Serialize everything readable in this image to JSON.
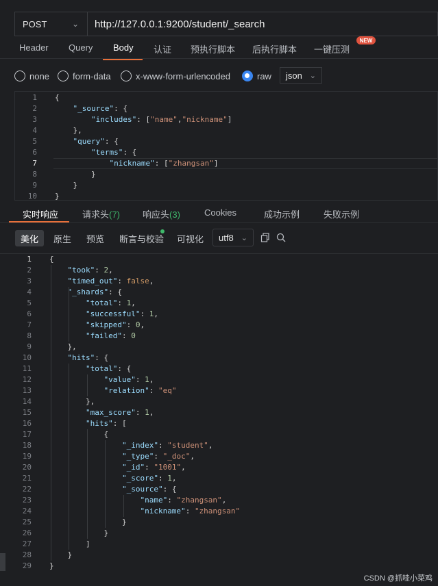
{
  "request": {
    "method": "POST",
    "url": "http://127.0.0.1:9200/student/_search"
  },
  "request_tabs": [
    {
      "label": "Header",
      "active": false
    },
    {
      "label": "Query",
      "active": false
    },
    {
      "label": "Body",
      "active": true
    },
    {
      "label": "认证",
      "active": false
    },
    {
      "label": "预执行脚本",
      "active": false
    },
    {
      "label": "后执行脚本",
      "active": false
    },
    {
      "label": "一键压测",
      "active": false,
      "badge": "NEW"
    }
  ],
  "body_types": [
    {
      "label": "none",
      "selected": false
    },
    {
      "label": "form-data",
      "selected": false
    },
    {
      "label": "x-www-form-urlencoded",
      "selected": false
    },
    {
      "label": "raw",
      "selected": true
    }
  ],
  "raw_format": "json",
  "request_body_lines": [
    "{",
    "    \"_source\": {",
    "        \"includes\": [\"name\",\"nickname\"]",
    "    },",
    "    \"query\": {",
    "        \"terms\": {",
    "            \"nickname\": [\"zhangsan\"]",
    "        }",
    "    }",
    "}"
  ],
  "request_current_line": 7,
  "response_tabs": [
    {
      "label": "实时响应",
      "active": true
    },
    {
      "label": "请求头",
      "count": "(7)"
    },
    {
      "label": "响应头",
      "count": "(3)"
    },
    {
      "label": "Cookies"
    },
    {
      "label": "成功示例"
    },
    {
      "label": "失败示例"
    }
  ],
  "response_views": [
    {
      "label": "美化",
      "active": true
    },
    {
      "label": "原生",
      "active": false
    },
    {
      "label": "预览",
      "active": false
    },
    {
      "label": "断言与校验",
      "active": false
    },
    {
      "label": "可视化",
      "active": false
    }
  ],
  "encoding": "utf8",
  "response_body_lines": [
    "{",
    "    \"took\": 2,",
    "    \"timed_out\": false,",
    "    \"_shards\": {",
    "        \"total\": 1,",
    "        \"successful\": 1,",
    "        \"skipped\": 0,",
    "        \"failed\": 0",
    "    },",
    "    \"hits\": {",
    "        \"total\": {",
    "            \"value\": 1,",
    "            \"relation\": \"eq\"",
    "        },",
    "        \"max_score\": 1,",
    "        \"hits\": [",
    "            {",
    "                \"_index\": \"student\",",
    "                \"_type\": \"_doc\",",
    "                \"_id\": \"1001\",",
    "                \"_score\": 1,",
    "                \"_source\": {",
    "                    \"name\": \"zhangsan\",",
    "                    \"nickname\": \"zhangsan\"",
    "                }",
    "            }",
    "        ]",
    "    }",
    "}"
  ],
  "response_current_line": 1,
  "watermark": "CSDN @抓哇小菜鸡",
  "colors": {
    "accent": "#e8703a",
    "key": "#9cdcfe",
    "string": "#ce9178",
    "number": "#b5cea8",
    "count": "#3fb96b",
    "radio_selected": "#3a86f0"
  }
}
